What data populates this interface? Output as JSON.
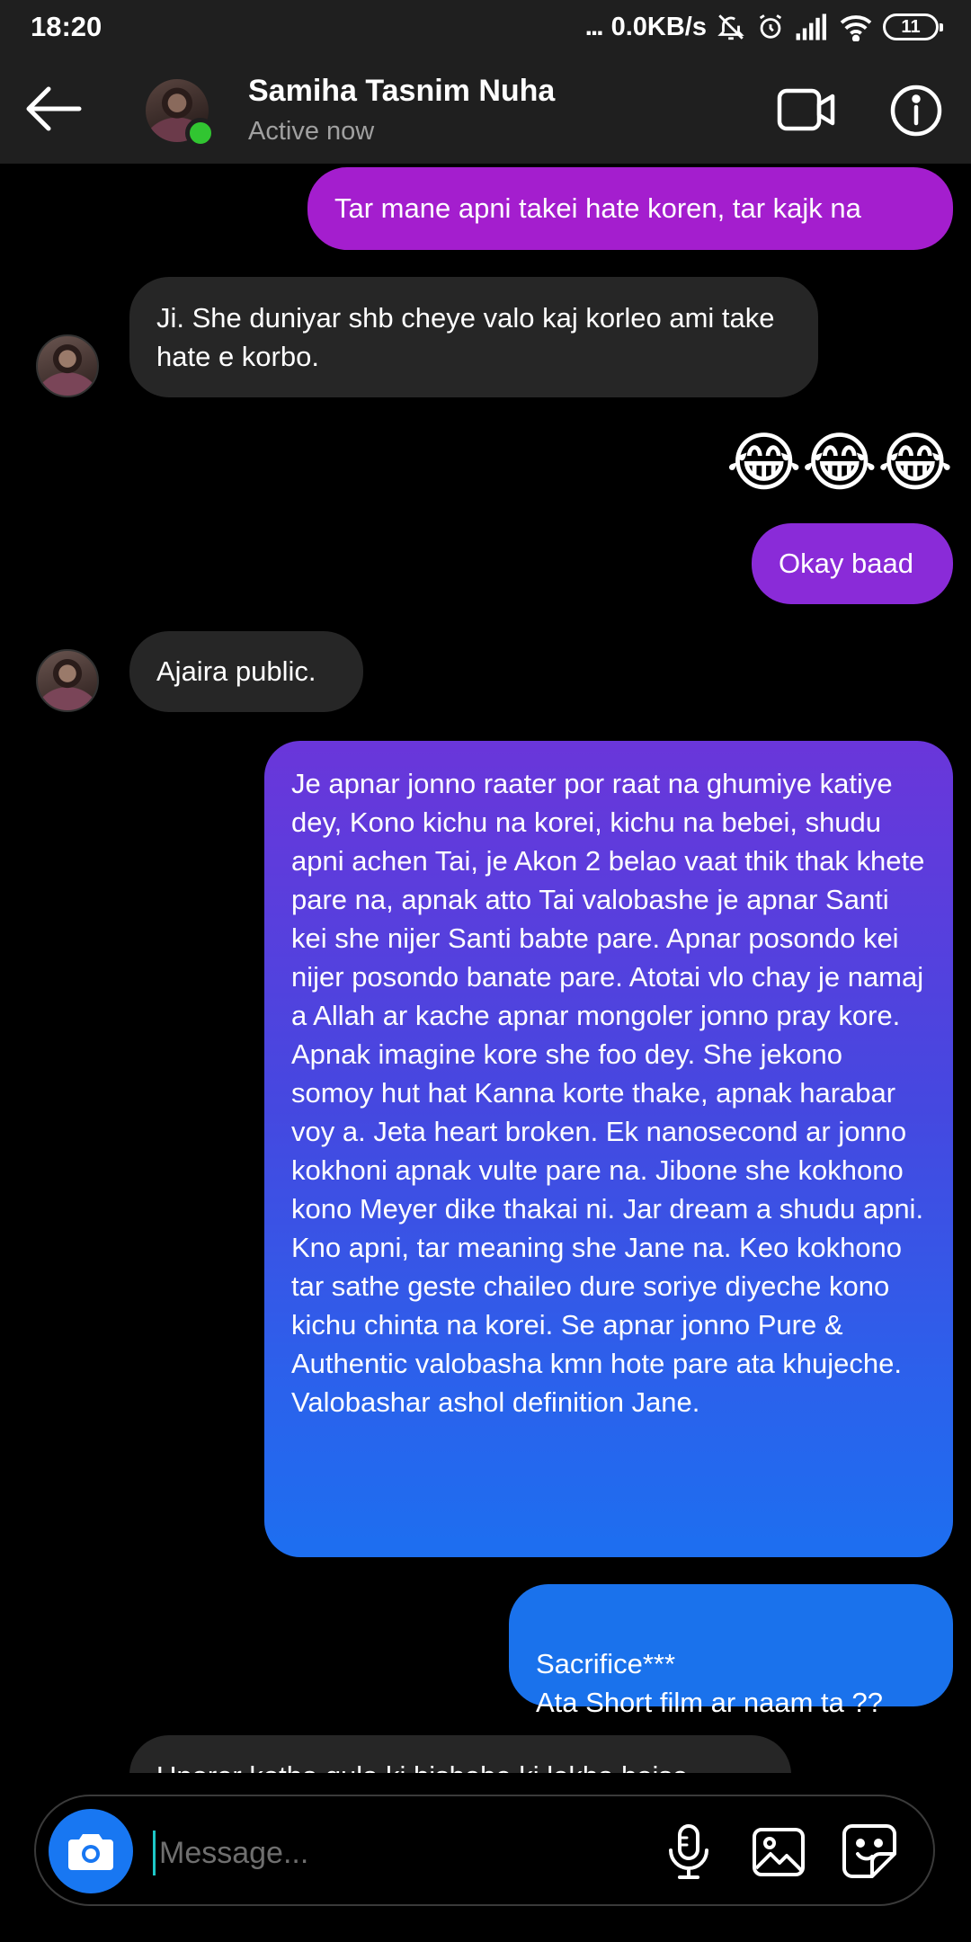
{
  "status_bar": {
    "time": "18:20",
    "dots": "...",
    "speed": "0.0KB/s",
    "battery": "11"
  },
  "header": {
    "name": "Samiha Tasnim Nuha",
    "status": "Active now",
    "online_color": "#31c531"
  },
  "messages": [
    {
      "from": "me",
      "text": "Tar mane apni takei hate koren, tar kajk na"
    },
    {
      "from": "them",
      "text": "Ji. She duniyar shb cheye valo kaj korleo ami take hate e korbo."
    },
    {
      "from": "me",
      "text": "😂😂😂"
    },
    {
      "from": "me",
      "text": "Okay baad"
    },
    {
      "from": "them",
      "text": "Ajaira public."
    },
    {
      "from": "me",
      "text": "Je apnar jonno raater por raat na ghumiye katiye dey, Kono kichu na korei, kichu na bebei, shudu apni achen Tai, je Akon 2 belao vaat thik thak khete pare na, apnak atto Tai valobashe je apnar Santi kei she nijer Santi babte pare. Apnar posondo kei nijer posondo banate pare. Atotai vlo chay je namaj a Allah ar kache apnar mongoler jonno pray kore. Apnak imagine kore she foo dey. She jekono somoy hut hat Kanna korte thake, apnak harabar voy a. Jeta heart broken. Ek nanosecond ar jonno kokhoni apnak vulte pare na. Jibone she kokhono kono Meyer dike thakai ni. Jar dream a shudu apni. Kno apni, tar meaning she Jane na. Keo kokhono tar sathe geste chaileo dure soriye diyeche kono kichu chinta na korei. Se apnar jonno Pure & Authentic valobasha kmn hote pare ata khujeche. Valobashar ashol definition Jane."
    },
    {
      "from": "me",
      "text": "Sacrifice***\nAta Short film ar naam ta ??"
    },
    {
      "from": "them",
      "text": "Uporer kotha gula ki hishebe ki lekha hoise"
    }
  ],
  "composer": {
    "placeholder": "Message..."
  },
  "colors": {
    "bubble_top": "#a21fd0",
    "bubble_mid": "#6a38e0",
    "bubble_bottom": "#1d6ff0",
    "received": "#262626",
    "camera_button": "#1877f2"
  }
}
